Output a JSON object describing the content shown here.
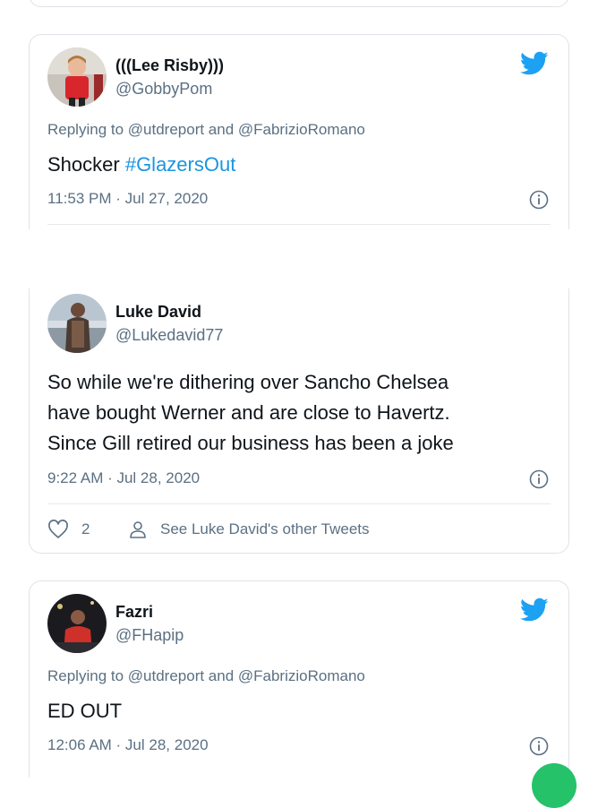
{
  "tweets": [
    {
      "name": "(((Lee Risby)))",
      "handle": "@GobbyPom",
      "replying": "Replying to @utdreport and @FabrizioRomano",
      "text_plain": "Shocker ",
      "hashtag": "#GlazersOut",
      "timestamp": "11:53 PM · Jul 27, 2020"
    },
    {
      "name": "Luke David",
      "handle": "@Lukedavid77",
      "text_lines": [
        "So while we're dithering over Sancho Chelsea",
        "have bought Werner and are close to Havertz.",
        "Since Gill retired  our business has been a joke"
      ],
      "timestamp": "9:22 AM · Jul 28, 2020",
      "likes": "2",
      "other_tweets": "See Luke David's other Tweets"
    },
    {
      "name": "Fazri",
      "handle": "@FHapip",
      "replying": "Replying to @utdreport and @FabrizioRomano",
      "text": "ED OUT",
      "timestamp": "12:06 AM · Jul 28, 2020"
    }
  ],
  "colors": {
    "twitter_blue": "#1da1f2",
    "hashtag": "#1b95e0",
    "secondary_text": "#5b7083"
  },
  "icons": [
    "twitter-bird-icon",
    "info-icon",
    "heart-icon",
    "person-icon"
  ]
}
